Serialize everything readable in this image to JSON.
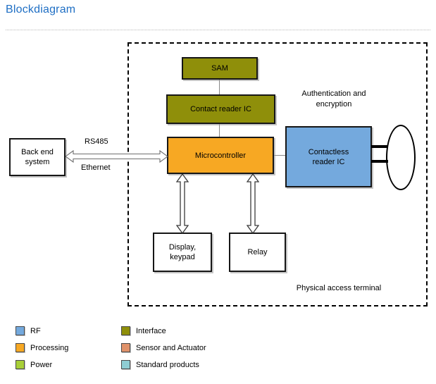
{
  "header": {
    "title": "Blockdiagram"
  },
  "diagram": {
    "boundary_label": "Physical access terminal",
    "blocks": {
      "sam": "SAM",
      "contact_reader": "Contact reader IC",
      "microcontroller": "Microcontroller",
      "contactless_reader": "Contactless\nreader IC",
      "contactless_reader_line1": "Contactless",
      "contactless_reader_line2": "reader IC",
      "backend_line1": "Back end",
      "backend_line2": "system",
      "display_line1": "Display,",
      "display_line2": "keypad",
      "relay": "Relay"
    },
    "labels": {
      "rs485": "RS485",
      "ethernet": "Ethernet",
      "authentication_line1": "Authentication and",
      "authentication_line2": "encryption"
    },
    "colors": {
      "rf": "#74a9dd",
      "processing": "#f7a823",
      "power": "#a8cf38",
      "interface": "#8f8f0a",
      "sensor_actuator": "#e0926a",
      "standard_products": "#8fcdd3",
      "title": "#1f6fc4",
      "block_border": "#161616",
      "connector": "#888888"
    }
  },
  "legend": {
    "items": [
      {
        "label": "RF",
        "color": "#74a9dd"
      },
      {
        "label": "Processing",
        "color": "#f7a823"
      },
      {
        "label": "Power",
        "color": "#a8cf38"
      },
      {
        "label": "Interface",
        "color": "#8f8f0a"
      },
      {
        "label": "Sensor and Actuator",
        "color": "#e0926a"
      },
      {
        "label": "Standard products",
        "color": "#8fcdd3"
      }
    ]
  }
}
